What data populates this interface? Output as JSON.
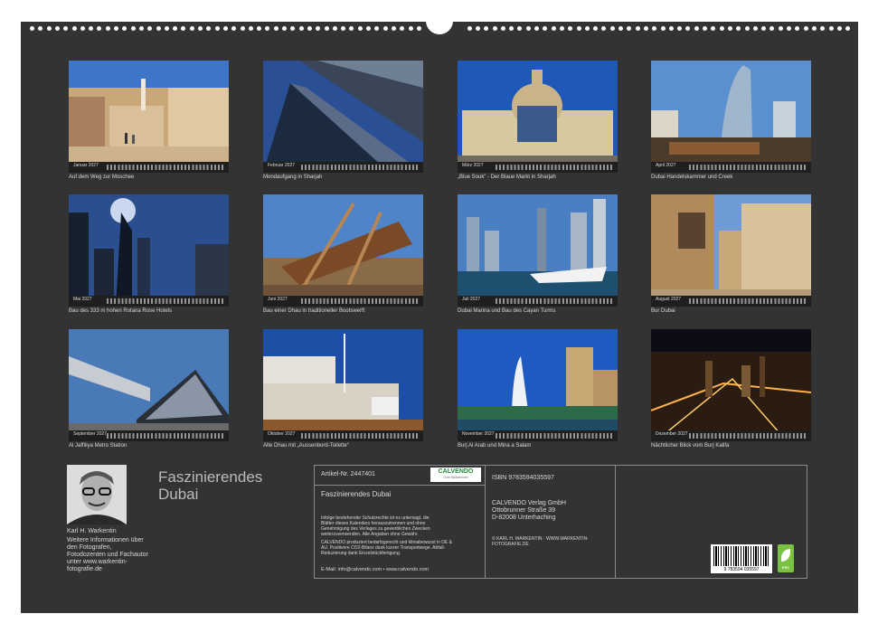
{
  "calendar": {
    "months": [
      {
        "label": "Januar 2027",
        "caption": "Auf dem Weg zur Moschee"
      },
      {
        "label": "Februar 2027",
        "caption": "Mondaufgang in Sharjah"
      },
      {
        "label": "März 2027",
        "caption": "„Blue Souk“ - Der Blaue Markt in Sharjah"
      },
      {
        "label": "April 2027",
        "caption": "Dubai Handelskammer und Creek"
      },
      {
        "label": "Mai 2027",
        "caption": "Bau des 333 m hohen Rotana Rose Hotels"
      },
      {
        "label": "Juni 2027",
        "caption": "Bau einer Dhau in traditioneller Bootswerft"
      },
      {
        "label": "Juli 2027",
        "caption": "Dubai Marina und Bau des Cayan Turms"
      },
      {
        "label": "August 2027",
        "caption": "Bur Dubai"
      },
      {
        "label": "September 2027",
        "caption": "Al Jaffiliya Metro Station"
      },
      {
        "label": "Oktober 2027",
        "caption": "Alte Dhau mit „Aussenbord-Toilette“"
      },
      {
        "label": "November 2027",
        "caption": "Burj Al Arab und Mina a Salam"
      },
      {
        "label": "Dezember 2027",
        "caption": "Nächtlicher Blick vom Burj Kalifa"
      }
    ]
  },
  "author": {
    "name": "Karl H. Warkentin",
    "bio": "Weitere Informationen über\nden Fotografen,\nFotodozenten und Fachautor\nunter www.warkentin-\nfotografie.de"
  },
  "title": "Faszinierendes\nDubai",
  "info": {
    "article": "Artikel-Nr. 2447401",
    "logo_word": "CALVENDO",
    "logo_sub": "Gute Bildkalender",
    "title": "Faszinierendes Dubai",
    "notice": "Infolge bestehender Schutzrechte ist es untersagt, die\nBlätter dieses Kalenders herauszutrennen und ohne\nGenehmigung des Verlages zu gewerblichen Zwecken\nweiterzuverwenden. Alle Angaben ohne Gewähr.",
    "eco_text": "CALVENDO produziert bedarfsgerecht und klimabewusst in DE &\nAU. Positivere CO2-Bilanz dank kurzer Transportwege. Abfall-\nReduzierung dank Einzelstückfertigung.",
    "contact": "E-Mail: info@calvendo.com • www.calvendo.com",
    "isbn": "ISBN 9783594035597",
    "publisher": "CALVENDO Verlag GmbH\nOttobrunner Straße 39\nD-82008 Unterhaching",
    "copyright": "© KARL H. WARKENTIN · WWW.WARKENTIN-\nFOTOGRAFIE.DE",
    "barcode_number": "9 783594 035597",
    "eco_badge": "FSC"
  },
  "colors": {
    "board": "#333333",
    "text": "#d8d8d8",
    "eco": "#7cc242"
  }
}
